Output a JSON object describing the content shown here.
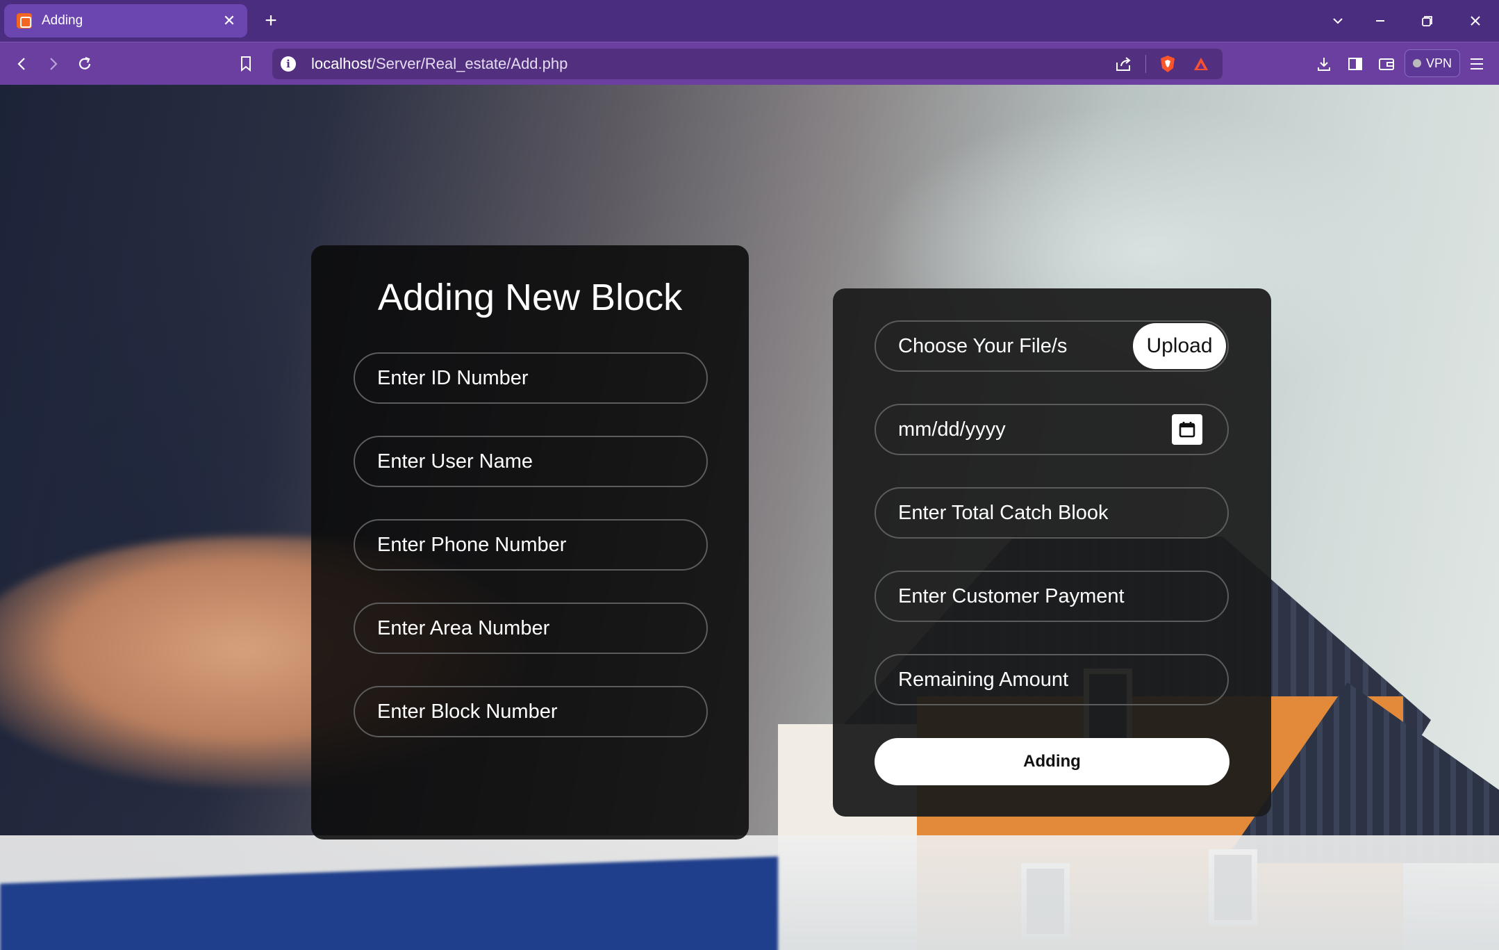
{
  "browser": {
    "tab_title": "Adding",
    "url_host": "localhost",
    "url_path": "/Server/Real_estate/Add.php",
    "vpn_label": "VPN",
    "accent_color": "#6b3fa0"
  },
  "form_left": {
    "title": "Adding New Block",
    "fields": [
      {
        "placeholder": "Enter ID Number"
      },
      {
        "placeholder": "Enter User Name"
      },
      {
        "placeholder": "Enter Phone Number"
      },
      {
        "placeholder": "Enter Area Number"
      },
      {
        "placeholder": "Enter Block Number"
      }
    ]
  },
  "form_right": {
    "file_label": "Choose Your File/s",
    "upload_label": "Upload",
    "date_placeholder": "mm/dd/yyyy",
    "fields": [
      {
        "placeholder": "Enter Total Catch Blook"
      },
      {
        "placeholder": "Enter Customer Payment"
      },
      {
        "placeholder": "Remaining Amount"
      }
    ],
    "submit_label": "Adding"
  },
  "icons": [
    "favicon-icon",
    "close-icon",
    "plus-icon",
    "chevron-down-icon",
    "minimize-icon",
    "restore-icon",
    "window-close-icon",
    "back-icon",
    "forward-icon",
    "reload-icon",
    "bookmark-icon",
    "info-icon",
    "share-icon",
    "brave-shield-icon",
    "rewards-icon",
    "download-icon",
    "sidebar-icon",
    "wallet-icon",
    "menu-icon",
    "calendar-icon"
  ]
}
